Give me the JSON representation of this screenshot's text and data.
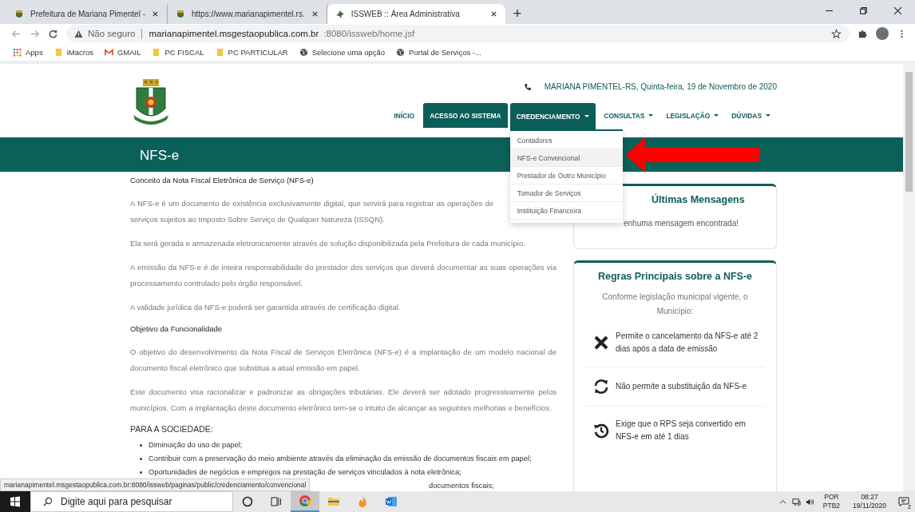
{
  "browser": {
    "tabs": [
      {
        "title": "Prefeitura de Mariana Pimentel -",
        "selected": false
      },
      {
        "title": "https://www.marianapimentel.rs.",
        "selected": false
      },
      {
        "title": "ISSWEB :: Área Administrativa",
        "selected": true
      }
    ],
    "new_tab": "+",
    "address": {
      "security": "Não seguro",
      "host": "marianapimentel.msgestaopublica.com.br",
      "path": ":8080/issweb/home.jsf"
    },
    "bookmarks": [
      {
        "label": "Apps",
        "kind": "apps"
      },
      {
        "label": "iMacros",
        "kind": "folder"
      },
      {
        "label": "GMAIL",
        "kind": "gmail"
      },
      {
        "label": "PC FISCAL",
        "kind": "folder"
      },
      {
        "label": "PC PARTICULAR",
        "kind": "folder"
      },
      {
        "label": "Selecione uma opção",
        "kind": "globe"
      },
      {
        "label": "Portal de Serviços -...",
        "kind": "globe"
      }
    ]
  },
  "header": {
    "contact": "MARIANA PIMENTEL-RS, Quinta-feira, 19 de Novembro de 2020",
    "nav": [
      {
        "label": "INÍCIO",
        "kind": "link",
        "dropdown": false,
        "expanded": false
      },
      {
        "label": "ACESSO AO SISTEMA",
        "kind": "button",
        "dropdown": false,
        "expanded": false
      },
      {
        "label": "CREDENCIAMENTO",
        "kind": "link",
        "dropdown": true,
        "expanded": true
      },
      {
        "label": "CONSULTAS",
        "kind": "link",
        "dropdown": true,
        "expanded": false
      },
      {
        "label": "LEGISLAÇÃO",
        "kind": "link",
        "dropdown": true,
        "expanded": false
      },
      {
        "label": "DÚVIDAS",
        "kind": "link",
        "dropdown": true,
        "expanded": false
      }
    ],
    "menu": [
      {
        "label": "Contadores",
        "selected": false
      },
      {
        "label": "NFS-e Convencional",
        "selected": true
      },
      {
        "label": "Prestador de Outro Município",
        "selected": false
      },
      {
        "label": "Tomador de Serviços",
        "selected": false
      },
      {
        "label": "Instituição Financeira",
        "selected": false
      }
    ]
  },
  "band_title": "NFS-e",
  "article": [
    {
      "kind": "heading",
      "text": "Conceito da Nota Fiscal Eletrônica de Serviço (NFS-e)"
    },
    {
      "kind": "paragraph",
      "text": "A NFS-e é um documento de existência exclusivamente digital, que servirá para registrar as operações de serviços sujeitos ao Imposto Sobre Serviço de Qualquer Natureza (ISSQN)."
    },
    {
      "kind": "paragraph",
      "text": "Ela será gerada e armazenada eletronicamente através de solução disponibilizada pela Prefeitura de cada município."
    },
    {
      "kind": "paragraph",
      "text": "A emissão da NFS-e é de inteira responsabilidade do prestador dos serviços que deverá documentar as suas operações via processamento controlado pelo órgão responsável."
    },
    {
      "kind": "paragraph",
      "text": "A validade jurídica da NFS-e poderá ser garantida através de certificação digital."
    },
    {
      "kind": "heading",
      "text": "Objetivo da Funcionalidade"
    },
    {
      "kind": "paragraph",
      "text": "O objetivo do desenvolvimento da Nota Fiscal de Serviços Eletrônica (NFS-e) é a implantação de um modelo nacional de documento fiscal eletrônico que substitua a atual emissão em papel."
    },
    {
      "kind": "paragraph",
      "text": "Este documento visa racionalizar e padronizar as obrigações tributárias. Ele deverá ser adotado progressivamente pelos municípios. Com a implantação deste documento eletrônico tem-se o intuito de alcançar as seguintes melhorias e benefícios."
    },
    {
      "kind": "section",
      "text": "PARA A SOCIEDADE:"
    },
    {
      "kind": "bullets",
      "items": [
        {
          "text": "Diminuição do uso de papel;",
          "kind": "full"
        },
        {
          "text": "Contribuir com a preservação do meio ambiente através da eliminação da emissão de documentos fiscais em papel;",
          "kind": "full"
        },
        {
          "text": "Oportunidades de negócios e empregos na prestação de serviços vinculados à nota eletrônica;",
          "kind": "full"
        },
        {
          "text": "documentos fiscais;",
          "kind": "partial"
        }
      ]
    }
  ],
  "messages": {
    "title": "Últimas Mensagens",
    "text": "enhuma mensagem encontrada!"
  },
  "rules": {
    "title": "Regras Principais sobre a NFS-e",
    "intro": "Conforme legislação municipal vigente, o Município:",
    "items": [
      {
        "kind": "cancel",
        "text": "Permite o cancelamento da NFS-e até 2 dias após a data de emissão"
      },
      {
        "kind": "sync",
        "text": "Não permite a substituição da NFS-e"
      },
      {
        "kind": "history",
        "text": "Exige que o RPS seja convertido em NFS-e em até 1 dias"
      }
    ]
  },
  "status_url": "marianapimentel.msgestaopublica.com.br:8080/issweb/paginas/public/credenciamento/convencional",
  "taskbar": {
    "search": {
      "placeholder": "Digite aqui para pesquisar"
    },
    "apps": [
      {
        "kind": "cortana",
        "selected": false
      },
      {
        "kind": "taskview",
        "selected": false
      },
      {
        "kind": "chrome",
        "selected": true
      },
      {
        "kind": "explorer",
        "selected": false
      },
      {
        "kind": "flame",
        "selected": false
      },
      {
        "kind": "word",
        "selected": false
      }
    ],
    "language": "POR",
    "layout": "PTB2",
    "time": "08:27",
    "date": "19/11/2020",
    "notifications": "2"
  }
}
